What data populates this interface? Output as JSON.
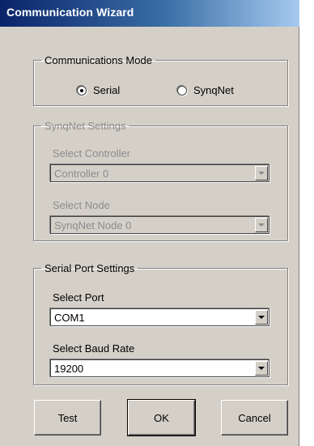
{
  "window": {
    "title": "Communication Wizard"
  },
  "mode": {
    "legend": "Communications Mode",
    "options": [
      {
        "label": "Serial",
        "selected": true
      },
      {
        "label": "SynqNet",
        "selected": false
      }
    ]
  },
  "synqnet": {
    "legend": "SynqNet Settings",
    "enabled": false,
    "controller_label": "Select Controller",
    "controller_value": "Controller 0",
    "node_label": "Select Node",
    "node_value": "SynqNet Node 0"
  },
  "serial": {
    "legend": "Serial Port Settings",
    "port_label": "Select Port",
    "port_value": "COM1",
    "baud_label": "Select Baud Rate",
    "baud_value": "19200"
  },
  "buttons": {
    "test": "Test",
    "ok": "OK",
    "cancel": "Cancel"
  },
  "colors": {
    "titlebar_start": "#0a246a",
    "titlebar_end": "#a6caf0",
    "dialog_bg": "#d4d0c8"
  }
}
